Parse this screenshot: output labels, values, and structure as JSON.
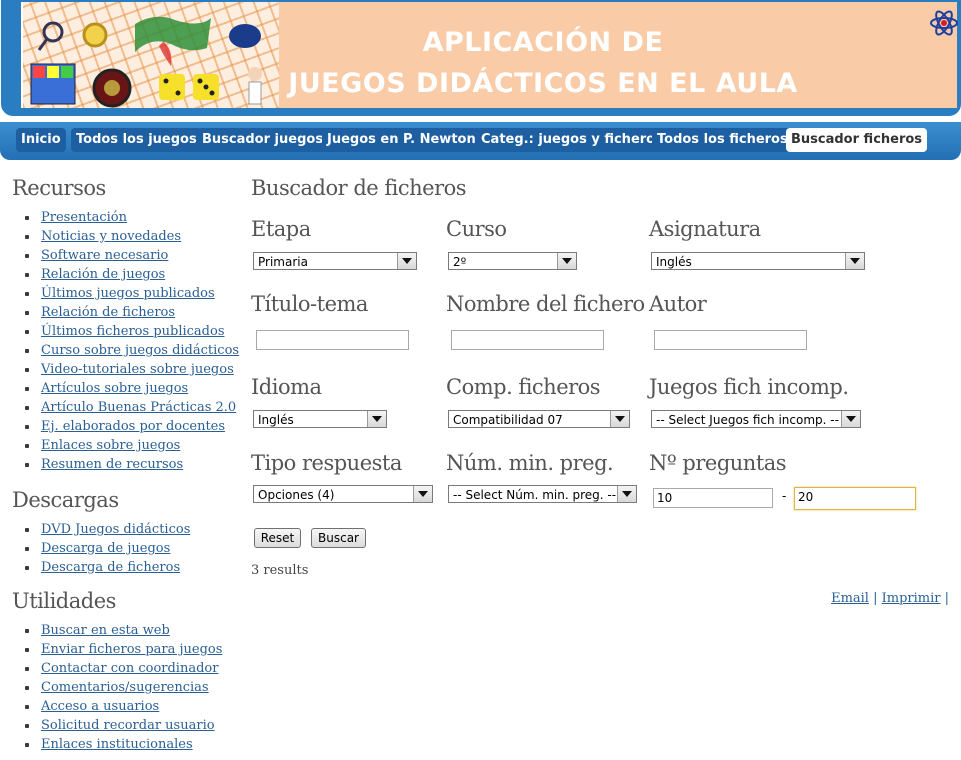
{
  "banner": {
    "title_line1": "APLICACIÓN DE",
    "title_line2": "JUEGOS DIDÁCTICOS EN EL AULA"
  },
  "nav": [
    {
      "label": "Inicio",
      "active": false
    },
    {
      "label": "Todos los juegos",
      "active": false
    },
    {
      "label": "Buscador juegos",
      "active": false
    },
    {
      "label": "Juegos en P. Newton",
      "active": false
    },
    {
      "label": "Categ.: juegos y ficheros",
      "active": false
    },
    {
      "label": "Todos los ficheros",
      "active": false
    },
    {
      "label": "Buscador ficheros",
      "active": true
    }
  ],
  "sidebar": {
    "recursos": {
      "heading": "Recursos",
      "items": [
        "Presentación",
        "Noticias y novedades",
        "Software necesario",
        "Relación de juegos",
        "Últimos juegos publicados",
        "Relación de ficheros",
        "Últimos ficheros publicados",
        "Curso sobre juegos didácticos",
        "Video-tutoriales sobre juegos",
        "Artículos sobre juegos",
        "Artículo Buenas Prácticas 2.0",
        "Ej. elaborados por docentes",
        "Enlaces sobre juegos",
        "Resumen de recursos"
      ]
    },
    "descargas": {
      "heading": "Descargas",
      "items": [
        "DVD Juegos didácticos",
        "Descarga de juegos",
        "Descarga de ficheros"
      ]
    },
    "utilidades": {
      "heading": "Utilidades",
      "items": [
        "Buscar en esta web",
        "Enviar ficheros para juegos",
        "Contactar con coordinador",
        "Comentarios/sugerencias",
        "Acceso a usuarios",
        "Solicitud recordar usuario",
        "Enlaces institucionales"
      ]
    }
  },
  "main": {
    "title": "Buscador de ficheros",
    "labels": {
      "etapa": "Etapa",
      "curso": "Curso",
      "asignatura": "Asignatura",
      "titulo": "Título-tema",
      "nombre": "Nombre del fichero",
      "autor": "Autor",
      "idioma": "Idioma",
      "comp": "Comp. ficheros",
      "incomp": "Juegos fich incomp.",
      "tipo": "Tipo respuesta",
      "minpreg": "Núm. min. preg.",
      "npreg": "Nº preguntas"
    },
    "values": {
      "etapa": "Primaria",
      "curso": "2º",
      "asignatura": "Inglés",
      "titulo": "",
      "nombre": "",
      "autor": "",
      "idioma": "Inglés",
      "comp": "Compatibilidad 07",
      "incomp": "-- Select Juegos fich incomp. --",
      "tipo": "Opciones (4)",
      "minpreg": "-- Select Núm. min. preg. --",
      "npreg_from": "10",
      "npreg_to": "20",
      "range_sep": "-"
    },
    "buttons": {
      "reset": "Reset",
      "buscar": "Buscar"
    },
    "results": "3 results",
    "links": {
      "email": "Email",
      "sep1": " | ",
      "imprimir": "Imprimir",
      "sep2": " |"
    }
  }
}
